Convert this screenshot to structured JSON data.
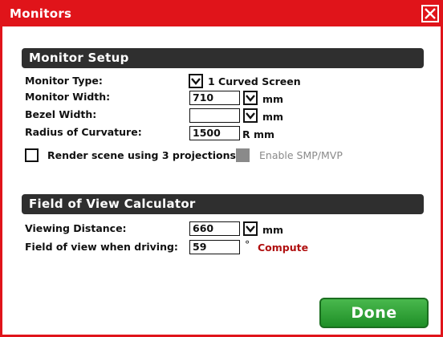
{
  "window": {
    "title": "Monitors",
    "accent_color": "#e0141a"
  },
  "monitor_setup": {
    "header": "Monitor Setup",
    "monitor_type_label": "Monitor Type:",
    "monitor_type_value": "1 Curved Screen",
    "monitor_width_label": "Monitor Width:",
    "monitor_width_value": "710",
    "monitor_width_unit": "mm",
    "bezel_width_label": "Bezel Width:",
    "bezel_width_value": "",
    "bezel_width_unit": "mm",
    "radius_label": "Radius of Curvature:",
    "radius_value": "1500",
    "radius_unit": "R mm",
    "render_projections_label": "Render scene using 3 projections",
    "render_projections_checked": false,
    "smp_label": "Enable SMP/MVP",
    "smp_enabled": false
  },
  "fov_calculator": {
    "header": "Field of View Calculator",
    "viewing_distance_label": "Viewing Distance:",
    "viewing_distance_value": "660",
    "viewing_distance_unit": "mm",
    "fov_label": "Field of view when driving:",
    "fov_value": "59",
    "fov_unit": "°",
    "compute_label": "Compute"
  },
  "footer": {
    "done_label": "Done",
    "done_color": "#2e9e35"
  }
}
